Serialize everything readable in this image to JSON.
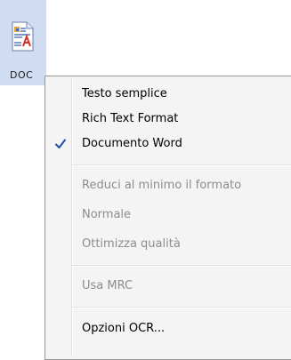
{
  "file_tile": {
    "label": "DOC",
    "icon": "word-document-icon"
  },
  "context_menu": {
    "items": [
      {
        "label": "Testo semplice",
        "enabled": true,
        "checked": false
      },
      {
        "label": "Rich Text Format",
        "enabled": true,
        "checked": false
      },
      {
        "label": "Documento Word",
        "enabled": true,
        "checked": true
      },
      {
        "label": "Reduci al minimo il formato",
        "enabled": false,
        "checked": false
      },
      {
        "label": "Normale",
        "enabled": false,
        "checked": false
      },
      {
        "label": "Ottimizza qualità",
        "enabled": false,
        "checked": false
      },
      {
        "label": "Usa MRC",
        "enabled": false,
        "checked": false
      },
      {
        "label": "Opzioni OCR...",
        "enabled": true,
        "checked": false
      }
    ],
    "check_icon": "checkmark-icon",
    "colors": {
      "check": "#1f4fa8",
      "disabled_text": "#8c8c8c",
      "tile_highlight": "#cfdcf2"
    }
  }
}
